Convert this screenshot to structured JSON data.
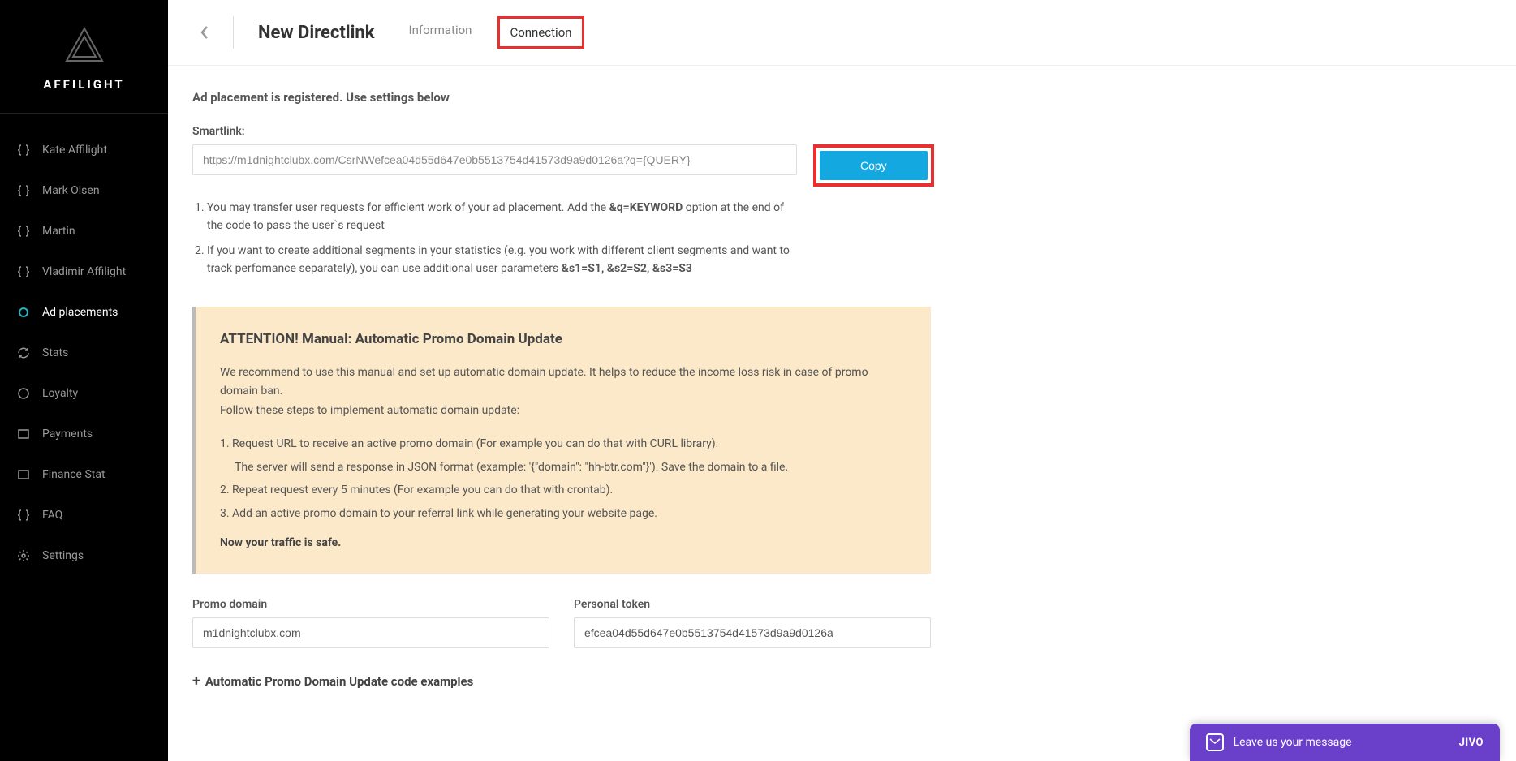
{
  "logo": {
    "text": "AFFILIGHT"
  },
  "sidebar": {
    "items": [
      {
        "label": "Kate Affilight",
        "icon": "braces-icon"
      },
      {
        "label": "Mark Olsen",
        "icon": "braces-icon"
      },
      {
        "label": "Martin",
        "icon": "braces-icon"
      },
      {
        "label": "Vladimir Affilight",
        "icon": "braces-icon"
      },
      {
        "label": "Ad placements",
        "icon": "circle-icon",
        "active": true
      },
      {
        "label": "Stats",
        "icon": "refresh-icon"
      },
      {
        "label": "Loyalty",
        "icon": "circle-outline-icon"
      },
      {
        "label": "Payments",
        "icon": "square-icon"
      },
      {
        "label": "Finance Stat",
        "icon": "square-icon"
      },
      {
        "label": "FAQ",
        "icon": "braces-icon"
      },
      {
        "label": "Settings",
        "icon": "gear-icon"
      }
    ]
  },
  "header": {
    "title": "New Directlink",
    "tabs": [
      {
        "label": "Information"
      },
      {
        "label": "Connection",
        "active": true
      }
    ]
  },
  "main": {
    "registered_heading": "Ad placement is registered. Use settings below",
    "smartlink": {
      "label": "Smartlink:",
      "value": "https://m1dnightclubx.com/CsrNWefcea04d55d647e0b5513754d41573d9a9d0126a?q={QUERY}",
      "copy_label": "Copy"
    },
    "notes": {
      "n1_a": "You may transfer user requests for efficient work of your ad placement. Add the ",
      "n1_b": "&q=KEYWORD",
      "n1_c": " option at the end of the code to pass the user`s request",
      "n2_a": "If you want to create additional segments in your statistics (e.g. you work with different client segments and want to track perfomance separately), you can use additional user parameters ",
      "n2_b": "&s1=S1, &s2=S2, &s3=S3"
    },
    "attention": {
      "title": "ATTENTION! Manual: Automatic Promo Domain Update",
      "intro1": "We recommend to use this manual and set up automatic domain update. It helps to reduce the income loss risk in case of promo domain ban.",
      "intro2": "Follow these steps to implement automatic domain update:",
      "step1": "1. Request URL to receive an active promo domain (For example you can do that with CURL library).",
      "step1b": "The server will send a response in JSON format (example: '{\"domain\": \"hh-btr.com\"}'). Save the domain to a file.",
      "step2": "2. Repeat request every 5 minutes (For example you can do that with crontab).",
      "step3": "3. Add an active promo domain to your referral link while generating your website page.",
      "safe": "Now your traffic is safe."
    },
    "promo_domain": {
      "label": "Promo domain",
      "value": "m1dnightclubx.com"
    },
    "personal_token": {
      "label": "Personal token",
      "value": "efcea04d55d647e0b5513754d41573d9a9d0126a"
    },
    "expander": {
      "label": "Automatic Promo Domain Update code examples"
    }
  },
  "chat": {
    "message": "Leave us your message",
    "brand": "JIVO"
  }
}
